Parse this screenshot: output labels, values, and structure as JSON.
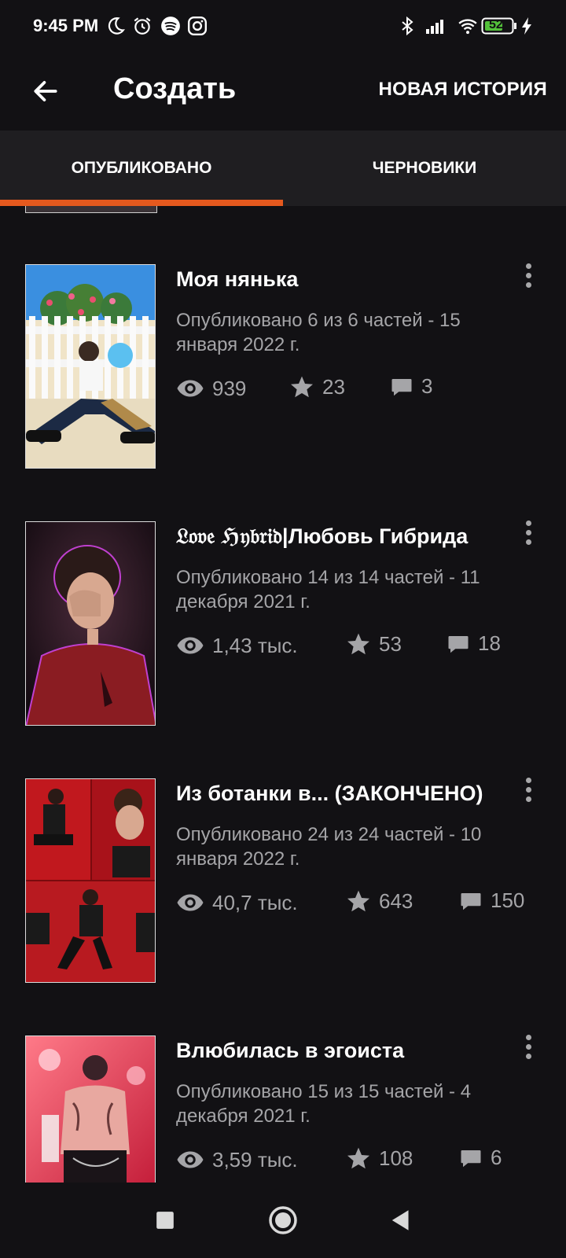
{
  "status_bar": {
    "time": "9:45 PM",
    "battery_level": "52",
    "icons": [
      "moon-icon",
      "alarm-icon",
      "spotify-icon",
      "instagram-icon",
      "bluetooth-icon",
      "signal-icon",
      "wifi-icon",
      "battery-icon",
      "charging-icon"
    ]
  },
  "app_bar": {
    "title": "Создать",
    "new_story_label": "НОВАЯ ИСТОРИЯ"
  },
  "tabs": [
    {
      "label": "ОПУБЛИКОВАНО",
      "active": true
    },
    {
      "label": "ЧЕРНОВИКИ",
      "active": false
    }
  ],
  "colors": {
    "accent": "#e5591e",
    "background": "#121114",
    "tab_background": "#1f1e21",
    "secondary_text": "#a5a5a8"
  },
  "stories": [
    {
      "title": "Моя нянька",
      "published": "Опубликовано 6 из 6 частей - 15 января 2022 г.",
      "views": "939",
      "votes": "23",
      "comments": "3"
    },
    {
      "title": "𝔏𝔬𝔳𝔢 ℌ𝔶𝔟𝔯𝔦𝔡|Любовь Гибрида",
      "published": "Опубликовано 14 из 14 частей - 11 декабря 2021 г.",
      "views": "1,43 тыс.",
      "votes": "53",
      "comments": "18"
    },
    {
      "title": "Из ботанки в...  (ЗАКОНЧЕНО)",
      "published": "Опубликовано 24 из 24 частей - 10 января 2022 г.",
      "views": "40,7 тыс.",
      "votes": "643",
      "comments": "150"
    },
    {
      "title": "Влюбилась в эгоиста",
      "published": "Опубликовано 15 из 15 частей - 4 декабря 2021 г.",
      "views": "3,59 тыс.",
      "votes": "108",
      "comments": "6"
    }
  ],
  "nav_bar": {
    "buttons": [
      "recents-square-icon",
      "home-circle-icon",
      "back-triangle-icon"
    ]
  }
}
